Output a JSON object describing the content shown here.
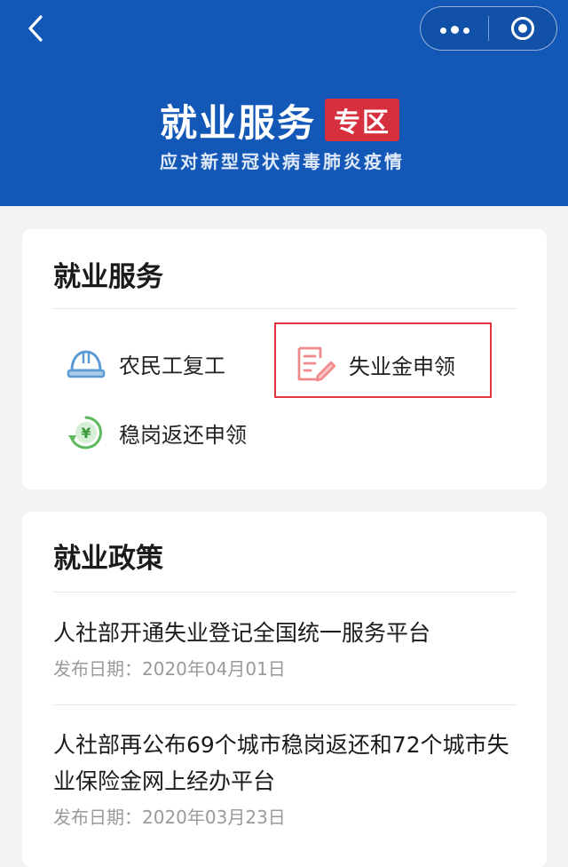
{
  "header": {
    "banner_title": "就业服务",
    "banner_tag": "专区",
    "banner_subtitle": "应对新型冠状病毒肺炎疫情",
    "icons": {
      "back": "back-chevron-icon",
      "more": "more-dots-icon",
      "close": "close-target-icon"
    }
  },
  "services": {
    "title": "就业服务",
    "items": [
      {
        "label": "农民工复工",
        "icon": "hard-hat-icon"
      },
      {
        "label": "失业金申领",
        "icon": "form-edit-icon",
        "highlighted": true
      },
      {
        "label": "稳岗返还申领",
        "icon": "yuan-refund-icon"
      }
    ]
  },
  "policies": {
    "title": "就业政策",
    "date_prefix": "发布日期：",
    "items": [
      {
        "title": "人社部开通失业登记全国统一服务平台",
        "date": "发布日期：2020年04月01日"
      },
      {
        "title": "人社部再公布69个城市稳岗返还和72个城市失业保险金网上经办平台",
        "date": "发布日期：2020年03月23日"
      }
    ]
  },
  "colors": {
    "header_bg": "#1458b7",
    "tag_red": "#d62f3e",
    "highlight_red": "#e0363d",
    "hat_blue": "#5b9bd5",
    "form_pink": "#f08a8a",
    "yuan_green": "#5cb85c"
  }
}
